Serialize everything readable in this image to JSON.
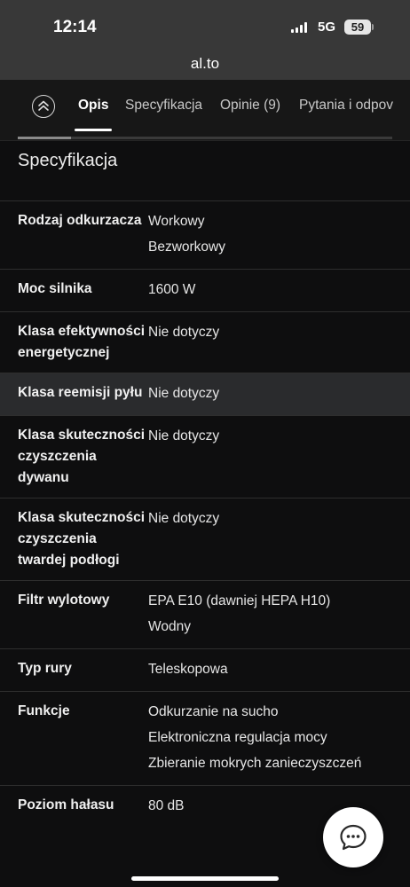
{
  "status": {
    "time": "12:14",
    "network": "5G",
    "battery": "59"
  },
  "browser": {
    "url": "al.to"
  },
  "tabs": [
    {
      "label": "Opis",
      "active": true
    },
    {
      "label": "Specyfikacja"
    },
    {
      "label": "Opinie (9)"
    },
    {
      "label": "Pytania i odpov"
    }
  ],
  "section_title": "Specyfikacja",
  "specs": [
    {
      "label": "Rodzaj odkurzacza",
      "values": [
        "Workowy",
        "Bezworkowy"
      ]
    },
    {
      "label": "Moc silnika",
      "values": [
        "1600 W"
      ]
    },
    {
      "label": "Klasa efektywności energetycznej",
      "values": [
        "Nie dotyczy"
      ]
    },
    {
      "label": "Klasa reemisji pyłu",
      "values": [
        "Nie dotyczy"
      ],
      "highlight": true
    },
    {
      "label": "Klasa skuteczności czyszczenia dywanu",
      "values": [
        "Nie dotyczy"
      ]
    },
    {
      "label": "Klasa skuteczności czyszczenia twardej podłogi",
      "values": [
        "Nie dotyczy"
      ]
    },
    {
      "label": "Filtr wylotowy",
      "values": [
        "EPA E10 (dawniej HEPA H10)",
        "Wodny"
      ]
    },
    {
      "label": "Typ rury",
      "values": [
        "Teleskopowa"
      ]
    },
    {
      "label": "Funkcje",
      "values": [
        "Odkurzanie na sucho",
        "Elektroniczna regulacja mocy",
        "Zbieranie mokrych zanieczyszczeń"
      ]
    },
    {
      "label": "Poziom hałasu",
      "values": [
        "80 dB"
      ]
    }
  ],
  "icons": {
    "collapse": "chevron-up-circle-icon",
    "chat": "chat-bubble-icon"
  }
}
